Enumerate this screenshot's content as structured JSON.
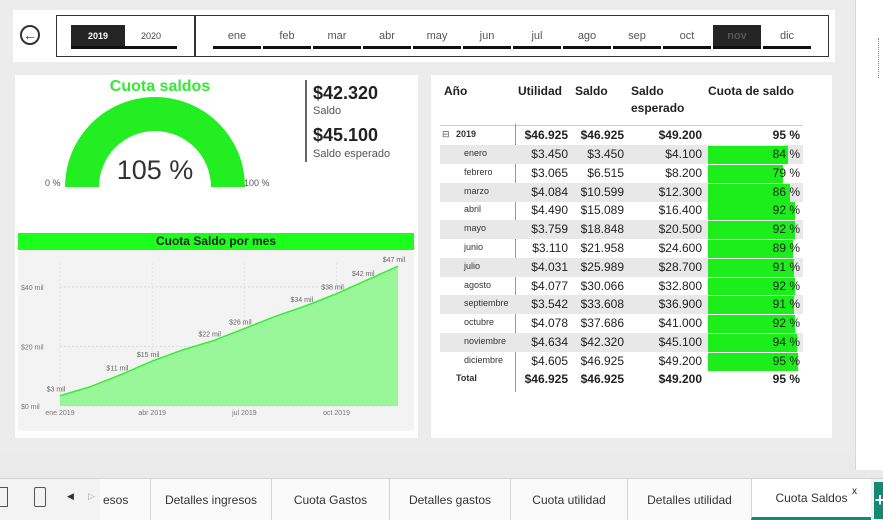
{
  "filters": {
    "years": [
      {
        "label": "2019",
        "selected": true
      },
      {
        "label": "2020",
        "selected": false
      }
    ],
    "months": [
      {
        "label": "ene",
        "selected": false
      },
      {
        "label": "feb",
        "selected": false
      },
      {
        "label": "mar",
        "selected": false
      },
      {
        "label": "abr",
        "selected": false
      },
      {
        "label": "may",
        "selected": false
      },
      {
        "label": "jun",
        "selected": false
      },
      {
        "label": "jul",
        "selected": false
      },
      {
        "label": "ago",
        "selected": false
      },
      {
        "label": "sep",
        "selected": false
      },
      {
        "label": "oct",
        "selected": false
      },
      {
        "label": "nov",
        "selected": true
      },
      {
        "label": "dic",
        "selected": false
      }
    ]
  },
  "gauge": {
    "title": "Cuota saldos",
    "value": "105 %",
    "value_fraction": 1.05,
    "min_label": "0 %",
    "max_label": "100 %",
    "color": "#22ee22"
  },
  "kpis": {
    "saldo_value": "$42.320",
    "saldo_label": "Saldo",
    "esperado_value": "$45.100",
    "esperado_label": "Saldo esperado"
  },
  "chart_title": "Cuota Saldo por mes",
  "chart_data": {
    "type": "area",
    "title": "Cuota Saldo por mes",
    "xlabel": "",
    "ylabel": "",
    "x": [
      "ene 2019",
      "feb 2019",
      "mar 2019",
      "abr 2019",
      "may 2019",
      "jun 2019",
      "jul 2019",
      "ago 2019",
      "sep 2019",
      "oct 2019",
      "nov 2019",
      "dic 2019"
    ],
    "values": [
      3.45,
      6.515,
      10.599,
      15.089,
      18.848,
      21.958,
      25.989,
      30.066,
      33.608,
      37.686,
      42.32,
      46.925
    ],
    "point_labels": [
      "$3 mil",
      "",
      "$11 mil",
      "$15 mil",
      "",
      "$22 mil",
      "$26 mil",
      "",
      "$34 mil",
      "$38 mil",
      "$42 mil",
      "$47 mil"
    ],
    "ylim": [
      0,
      48
    ],
    "y_ticks": [
      {
        "value": 0,
        "label": "$0 mil"
      },
      {
        "value": 20,
        "label": "$20 mil"
      },
      {
        "value": 40,
        "label": "$40 mil"
      }
    ],
    "x_ticks": [
      {
        "index": 0,
        "label": "ene 2019"
      },
      {
        "index": 3,
        "label": "abr 2019"
      },
      {
        "index": 6,
        "label": "jul 2019"
      },
      {
        "index": 9,
        "label": "oct 2019"
      }
    ],
    "grid": true,
    "fill_color": "#99f799",
    "line_color": "#33ee33"
  },
  "matrix": {
    "headers": {
      "anio": "Año",
      "utilidad": "Utilidad",
      "saldo": "Saldo",
      "saldo_esperado_1": "Saldo",
      "saldo_esperado_2": "esperado",
      "cuota": "Cuota de saldo"
    },
    "year_row": {
      "expander": "⊟",
      "label": "2019",
      "utilidad": "$46.925",
      "saldo": "$46.925",
      "esperado": "$49.200",
      "cuota": "95 %"
    },
    "rows": [
      {
        "label": "enero",
        "utilidad": "$3.450",
        "saldo": "$3.450",
        "esperado": "$4.100",
        "cuota": "84 %",
        "fraction": 0.84
      },
      {
        "label": "febrero",
        "utilidad": "$3.065",
        "saldo": "$6.515",
        "esperado": "$8.200",
        "cuota": "79 %",
        "fraction": 0.79
      },
      {
        "label": "marzo",
        "utilidad": "$4.084",
        "saldo": "$10.599",
        "esperado": "$12.300",
        "cuota": "86 %",
        "fraction": 0.86
      },
      {
        "label": "abril",
        "utilidad": "$4.490",
        "saldo": "$15.089",
        "esperado": "$16.400",
        "cuota": "92 %",
        "fraction": 0.92
      },
      {
        "label": "mayo",
        "utilidad": "$3.759",
        "saldo": "$18.848",
        "esperado": "$20.500",
        "cuota": "92 %",
        "fraction": 0.92
      },
      {
        "label": "junio",
        "utilidad": "$3.110",
        "saldo": "$21.958",
        "esperado": "$24.600",
        "cuota": "89 %",
        "fraction": 0.89
      },
      {
        "label": "julio",
        "utilidad": "$4.031",
        "saldo": "$25.989",
        "esperado": "$28.700",
        "cuota": "91 %",
        "fraction": 0.91
      },
      {
        "label": "agosto",
        "utilidad": "$4.077",
        "saldo": "$30.066",
        "esperado": "$32.800",
        "cuota": "92 %",
        "fraction": 0.92
      },
      {
        "label": "septiembre",
        "utilidad": "$3.542",
        "saldo": "$33.608",
        "esperado": "$36.900",
        "cuota": "91 %",
        "fraction": 0.91
      },
      {
        "label": "octubre",
        "utilidad": "$4.078",
        "saldo": "$37.686",
        "esperado": "$41.000",
        "cuota": "92 %",
        "fraction": 0.92
      },
      {
        "label": "noviembre",
        "utilidad": "$4.634",
        "saldo": "$42.320",
        "esperado": "$45.100",
        "cuota": "94 %",
        "fraction": 0.94
      },
      {
        "label": "diciembre",
        "utilidad": "$4.605",
        "saldo": "$46.925",
        "esperado": "$49.200",
        "cuota": "95 %",
        "fraction": 0.95
      }
    ],
    "total_row": {
      "label": "Total",
      "utilidad": "$46.925",
      "saldo": "$46.925",
      "esperado": "$49.200",
      "cuota": "95 %"
    },
    "bar_color": "#1bee1b"
  },
  "tabs": {
    "items": [
      {
        "label": "esos",
        "active": false
      },
      {
        "label": "Detalles ingresos",
        "active": false
      },
      {
        "label": "Cuota Gastos",
        "active": false
      },
      {
        "label": "Detalles gastos",
        "active": false
      },
      {
        "label": "Cuota utilidad",
        "active": false
      },
      {
        "label": "Detalles utilidad",
        "active": false
      },
      {
        "label": "Cuota Saldos",
        "active": true
      }
    ],
    "close_label": "x",
    "add_label": "+",
    "accent": "#138a72"
  }
}
